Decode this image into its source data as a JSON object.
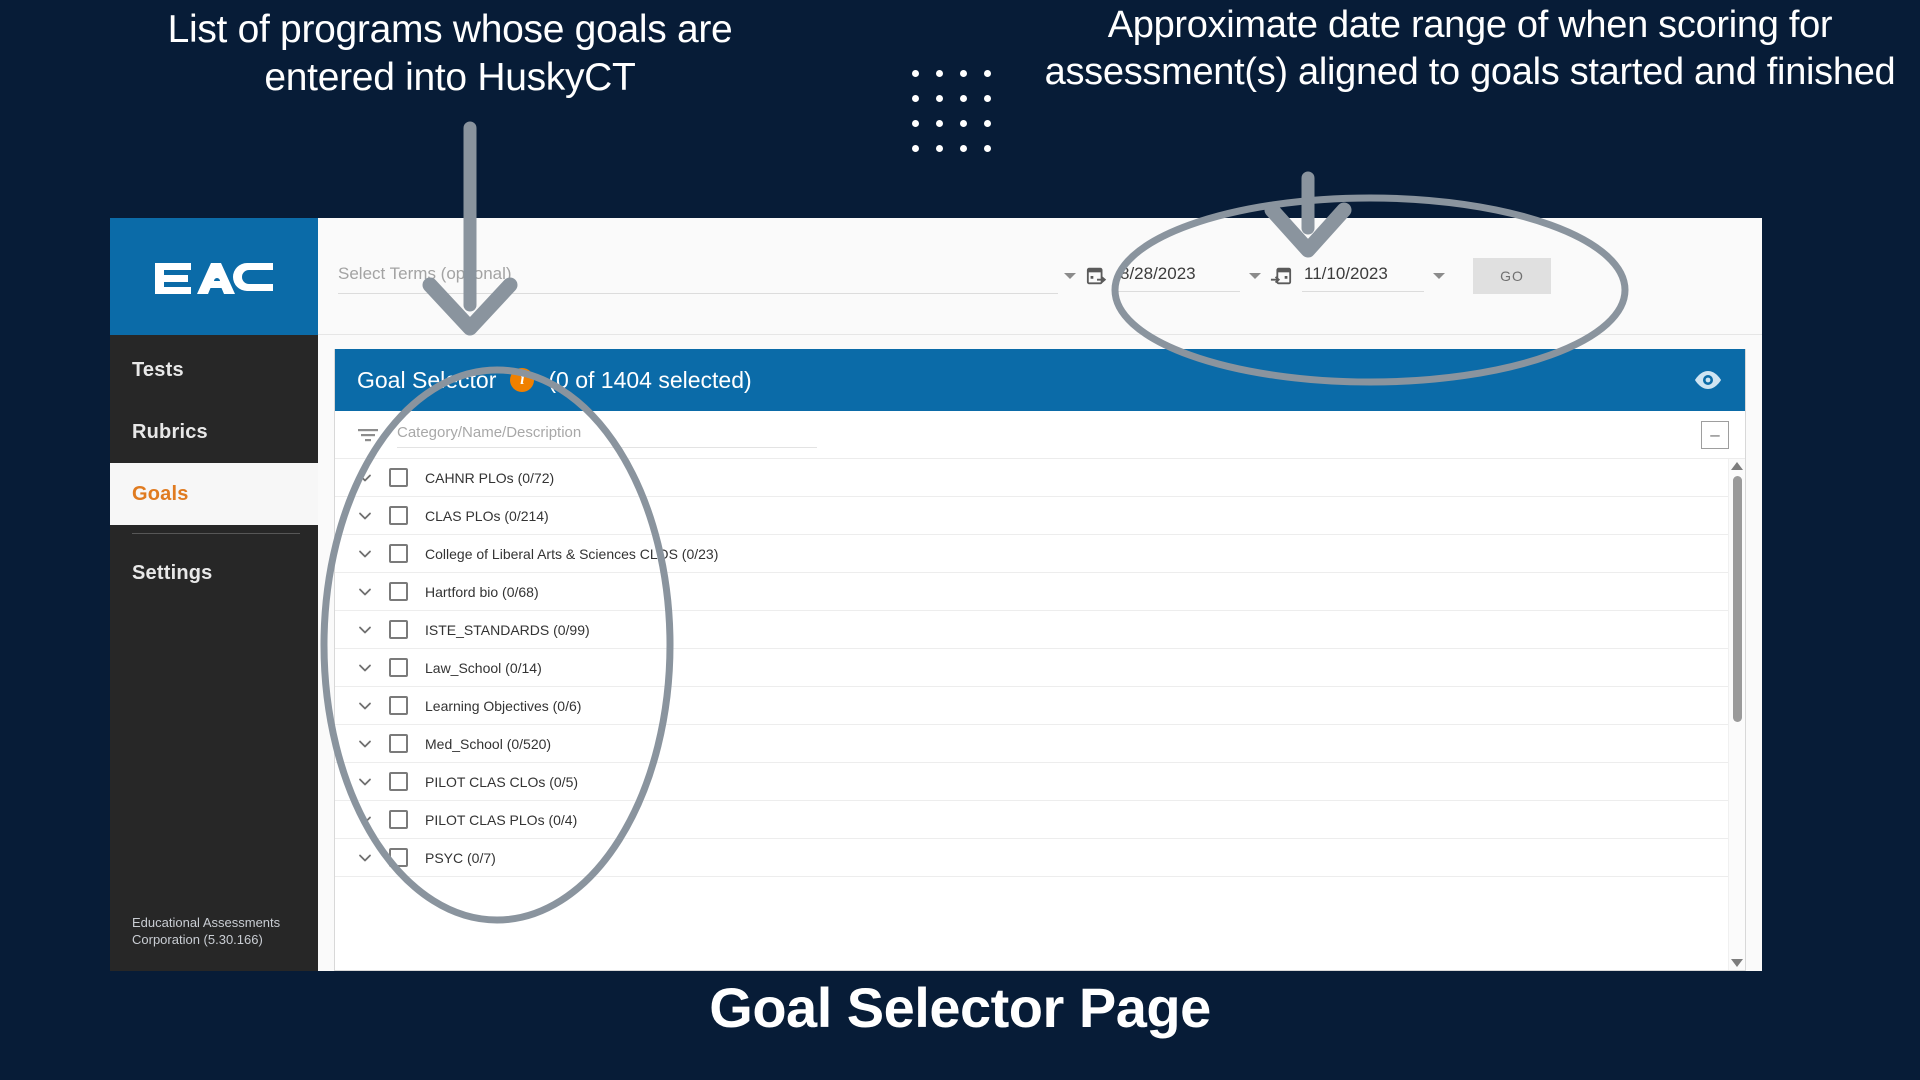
{
  "slide": {
    "title": "Goal Selector Page",
    "annotation_left": "List of programs whose goals are entered into HuskyCT",
    "annotation_right": "Approximate date range of when scoring for assessment(s) aligned to goals started and finished",
    "background_color": "#071c37",
    "accent_color": "#0b6ba8",
    "arrow_color": "#8a949e"
  },
  "sidebar": {
    "logo": "EAC",
    "items": [
      {
        "label": "Tests",
        "active": false
      },
      {
        "label": "Rubrics",
        "active": false
      },
      {
        "label": "Goals",
        "active": true
      },
      {
        "label": "Settings",
        "active": false
      }
    ],
    "footer_line1": "Educational Assessments",
    "footer_line2": "Corporation (5.30.166)"
  },
  "toolbar": {
    "terms_placeholder": "Select Terms (optional)",
    "terms_value": "",
    "start_date": "8/28/2023",
    "end_date": "11/10/2023",
    "go_label": "GO",
    "start_icon": "calendar-start-icon",
    "end_icon": "calendar-end-icon"
  },
  "card": {
    "title": "Goal Selector",
    "info_icon": "i",
    "count_text": "(0 of 1404 selected)",
    "eye_icon": "eye-icon",
    "filter_placeholder": "Category/Name/Description",
    "filter_value": "",
    "collapse_label": "–",
    "rows": [
      {
        "label": "CAHNR PLOs (0/72)"
      },
      {
        "label": "CLAS PLOs (0/214)"
      },
      {
        "label": "College of Liberal Arts & Sciences CLOS (0/23)"
      },
      {
        "label": "Hartford bio (0/68)"
      },
      {
        "label": "ISTE_STANDARDS (0/99)"
      },
      {
        "label": "Law_School (0/14)"
      },
      {
        "label": "Learning Objectives (0/6)"
      },
      {
        "label": "Med_School (0/520)"
      },
      {
        "label": "PILOT CLAS CLOs (0/5)"
      },
      {
        "label": "PILOT CLAS PLOs (0/4)"
      },
      {
        "label": "PSYC (0/7)"
      }
    ]
  }
}
